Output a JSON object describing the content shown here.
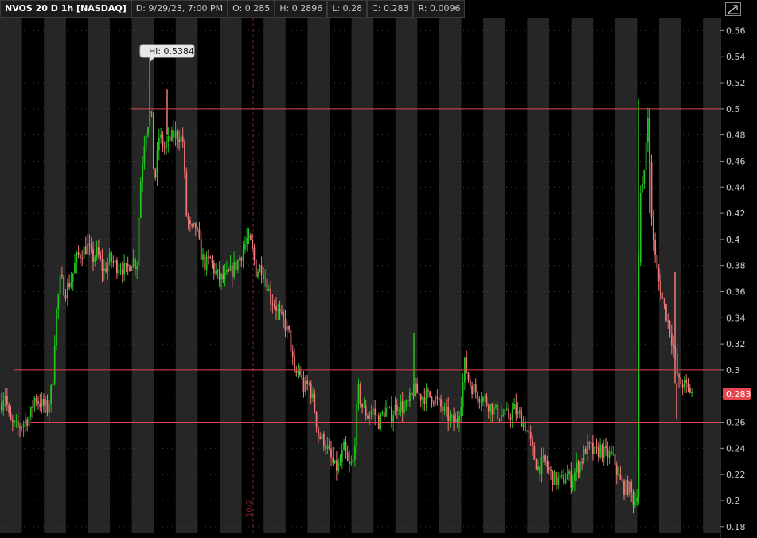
{
  "header": {
    "symbol": "NVOS 20 D 1h [NASDAQ]",
    "date": "D: 9/29/23, 7:00 PM",
    "open": "O: 0.285",
    "high": "H: 0.2896",
    "low": "L: 0.28",
    "close": "C: 0.283",
    "range": "R: 0.0096"
  },
  "icons": {
    "expand": "expand-chart-icon"
  },
  "colors": {
    "up": "#22c41f",
    "down": "#f0787a",
    "hline": "#d9474f",
    "price_badge": "#e8474f",
    "band_light": "#262626",
    "band_dark": "#000000"
  },
  "chart_data": {
    "type": "candlestick",
    "ylim": [
      0.175,
      0.57
    ],
    "yticks": [
      "0.18",
      "0.2",
      "0.22",
      "0.24",
      "0.26",
      "0.28",
      "0.3",
      "0.32",
      "0.34",
      "0.36",
      "0.38",
      "0.4",
      "0.42",
      "0.44",
      "0.46",
      "0.48",
      "0.5",
      "0.52",
      "0.54",
      "0.56"
    ],
    "horizontal_lines": [
      0.5,
      0.3,
      0.26
    ],
    "high_label": "Hi: 0.5384",
    "last_price": "0.283",
    "vertical_marker_label": "10/2",
    "path": [
      [
        0,
        0.27
      ],
      [
        6,
        0.285
      ],
      [
        12,
        0.26
      ],
      [
        22,
        0.255
      ],
      [
        30,
        0.26
      ],
      [
        38,
        0.265
      ],
      [
        44,
        0.28
      ],
      [
        50,
        0.275
      ],
      [
        60,
        0.27
      ],
      [
        66,
        0.29
      ],
      [
        70,
        0.34
      ],
      [
        76,
        0.37
      ],
      [
        82,
        0.36
      ],
      [
        90,
        0.37
      ],
      [
        96,
        0.385
      ],
      [
        102,
        0.39
      ],
      [
        110,
        0.395
      ],
      [
        116,
        0.385
      ],
      [
        122,
        0.39
      ],
      [
        130,
        0.375
      ],
      [
        138,
        0.385
      ],
      [
        146,
        0.38
      ],
      [
        152,
        0.38
      ],
      [
        158,
        0.375
      ],
      [
        166,
        0.385
      ],
      [
        172,
        0.38
      ],
      [
        176,
        0.44
      ],
      [
        182,
        0.48
      ],
      [
        186,
        0.49
      ],
      [
        190,
        0.5
      ],
      [
        194,
        0.44
      ],
      [
        200,
        0.48
      ],
      [
        206,
        0.47
      ],
      [
        212,
        0.475
      ],
      [
        218,
        0.48
      ],
      [
        224,
        0.48
      ],
      [
        230,
        0.475
      ],
      [
        234,
        0.42
      ],
      [
        240,
        0.405
      ],
      [
        246,
        0.41
      ],
      [
        252,
        0.39
      ],
      [
        258,
        0.38
      ],
      [
        264,
        0.385
      ],
      [
        270,
        0.375
      ],
      [
        276,
        0.37
      ],
      [
        282,
        0.37
      ],
      [
        290,
        0.375
      ],
      [
        296,
        0.38
      ],
      [
        304,
        0.39
      ],
      [
        310,
        0.4
      ],
      [
        316,
        0.395
      ],
      [
        322,
        0.375
      ],
      [
        328,
        0.38
      ],
      [
        334,
        0.37
      ],
      [
        340,
        0.355
      ],
      [
        346,
        0.35
      ],
      [
        352,
        0.34
      ],
      [
        358,
        0.335
      ],
      [
        364,
        0.325
      ],
      [
        370,
        0.295
      ],
      [
        376,
        0.3
      ],
      [
        382,
        0.285
      ],
      [
        388,
        0.29
      ],
      [
        394,
        0.275
      ],
      [
        400,
        0.25
      ],
      [
        408,
        0.245
      ],
      [
        414,
        0.235
      ],
      [
        420,
        0.225
      ],
      [
        426,
        0.225
      ],
      [
        432,
        0.24
      ],
      [
        438,
        0.225
      ],
      [
        444,
        0.23
      ],
      [
        450,
        0.285
      ],
      [
        456,
        0.27
      ],
      [
        462,
        0.265
      ],
      [
        468,
        0.27
      ],
      [
        476,
        0.26
      ],
      [
        484,
        0.27
      ],
      [
        492,
        0.265
      ],
      [
        500,
        0.275
      ],
      [
        508,
        0.27
      ],
      [
        514,
        0.275
      ],
      [
        520,
        0.285
      ],
      [
        528,
        0.28
      ],
      [
        536,
        0.28
      ],
      [
        544,
        0.28
      ],
      [
        550,
        0.275
      ],
      [
        556,
        0.27
      ],
      [
        562,
        0.265
      ],
      [
        568,
        0.26
      ],
      [
        574,
        0.26
      ],
      [
        580,
        0.28
      ],
      [
        584,
        0.305
      ],
      [
        590,
        0.29
      ],
      [
        596,
        0.285
      ],
      [
        604,
        0.28
      ],
      [
        612,
        0.275
      ],
      [
        620,
        0.27
      ],
      [
        628,
        0.265
      ],
      [
        634,
        0.265
      ],
      [
        640,
        0.265
      ],
      [
        646,
        0.27
      ],
      [
        652,
        0.265
      ],
      [
        658,
        0.26
      ],
      [
        664,
        0.25
      ],
      [
        670,
        0.235
      ],
      [
        676,
        0.225
      ],
      [
        684,
        0.23
      ],
      [
        692,
        0.22
      ],
      [
        698,
        0.215
      ],
      [
        706,
        0.215
      ],
      [
        712,
        0.22
      ],
      [
        718,
        0.215
      ],
      [
        724,
        0.225
      ],
      [
        730,
        0.23
      ],
      [
        736,
        0.24
      ],
      [
        742,
        0.24
      ],
      [
        748,
        0.235
      ],
      [
        754,
        0.24
      ],
      [
        760,
        0.235
      ],
      [
        766,
        0.235
      ],
      [
        772,
        0.23
      ],
      [
        778,
        0.215
      ],
      [
        784,
        0.21
      ],
      [
        790,
        0.21
      ],
      [
        796,
        0.2
      ],
      [
        800,
        0.2
      ],
      [
        803,
        0.43
      ],
      [
        808,
        0.44
      ],
      [
        814,
        0.5
      ],
      [
        818,
        0.42
      ],
      [
        824,
        0.38
      ],
      [
        830,
        0.36
      ],
      [
        836,
        0.345
      ],
      [
        842,
        0.33
      ],
      [
        848,
        0.31
      ],
      [
        852,
        0.29
      ],
      [
        858,
        0.29
      ],
      [
        864,
        0.285
      ],
      [
        870,
        0.283
      ]
    ]
  }
}
